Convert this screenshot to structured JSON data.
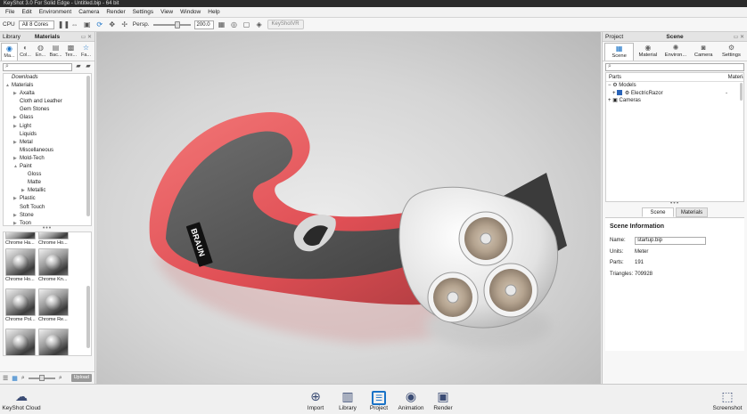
{
  "window": {
    "title": "KeyShot 3.0 For Solid Edge - Untitled.bip - 64 bit"
  },
  "menu": [
    "File",
    "Edit",
    "Environment",
    "Camera",
    "Render",
    "Settings",
    "View",
    "Window",
    "Help"
  ],
  "toolbar": {
    "cpu_label": "CPU",
    "cpu_value": "All 8 Cores",
    "persp_label": "Persp.",
    "fov_value": "200.0",
    "keyshotvr_label": "KeyShotVR"
  },
  "library": {
    "header_left": "Library",
    "header_title": "Materials",
    "tabs": [
      {
        "label": "Ma...",
        "icon": "materials-icon"
      },
      {
        "label": "Col...",
        "icon": "colors-icon"
      },
      {
        "label": "En...",
        "icon": "environments-icon"
      },
      {
        "label": "Bac...",
        "icon": "backplates-icon"
      },
      {
        "label": "Tex...",
        "icon": "textures-icon"
      },
      {
        "label": "Fa...",
        "icon": "favorites-icon"
      }
    ],
    "tree": [
      {
        "label": "Downloads",
        "indent": 0,
        "italic": true,
        "arrow": ""
      },
      {
        "label": "Materials",
        "indent": 0,
        "italic": false,
        "arrow": "▲"
      },
      {
        "label": "Axalta",
        "indent": 1,
        "italic": false,
        "arrow": "▶"
      },
      {
        "label": "Cloth and Leather",
        "indent": 1,
        "italic": false,
        "arrow": ""
      },
      {
        "label": "Gem Stones",
        "indent": 1,
        "italic": false,
        "arrow": ""
      },
      {
        "label": "Glass",
        "indent": 1,
        "italic": false,
        "arrow": "▶"
      },
      {
        "label": "Light",
        "indent": 1,
        "italic": false,
        "arrow": "▶"
      },
      {
        "label": "Liquids",
        "indent": 1,
        "italic": false,
        "arrow": ""
      },
      {
        "label": "Metal",
        "indent": 1,
        "italic": false,
        "arrow": "▶"
      },
      {
        "label": "Miscellaneous",
        "indent": 1,
        "italic": false,
        "arrow": ""
      },
      {
        "label": "Mold-Tech",
        "indent": 1,
        "italic": false,
        "arrow": "▶"
      },
      {
        "label": "Paint",
        "indent": 1,
        "italic": false,
        "arrow": "▲"
      },
      {
        "label": "Gloss",
        "indent": 2,
        "italic": false,
        "arrow": ""
      },
      {
        "label": "Matte",
        "indent": 2,
        "italic": false,
        "arrow": ""
      },
      {
        "label": "Metallic",
        "indent": 2,
        "italic": false,
        "arrow": "▶"
      },
      {
        "label": "Plastic",
        "indent": 1,
        "italic": false,
        "arrow": "▶"
      },
      {
        "label": "Soft Touch",
        "indent": 1,
        "italic": false,
        "arrow": ""
      },
      {
        "label": "Stone",
        "indent": 1,
        "italic": false,
        "arrow": "▶"
      },
      {
        "label": "Toon",
        "indent": 1,
        "italic": false,
        "arrow": "▶"
      }
    ],
    "thumbnails": [
      "Chrome Ha...",
      "Chrome Ho...",
      "Chrome Ho...",
      "Chrome Kn...",
      "Chrome Pol...",
      "Chrome Re..."
    ],
    "upload_label": "Upload"
  },
  "project": {
    "header_left": "Project",
    "header_title": "Scene",
    "tabs": [
      {
        "label": "Scene",
        "icon": "scene-icon"
      },
      {
        "label": "Material",
        "icon": "material-icon"
      },
      {
        "label": "Environ...",
        "icon": "environment-icon"
      },
      {
        "label": "Camera",
        "icon": "camera-icon"
      },
      {
        "label": "Settings",
        "icon": "settings-icon"
      }
    ],
    "tree_header": {
      "parts": "Parts",
      "material": "Material"
    },
    "tree": [
      {
        "label": "Models",
        "indent": 0
      },
      {
        "label": "ElectricRazor",
        "indent": 1,
        "dash": "-"
      },
      {
        "label": "Cameras",
        "indent": 0
      }
    ],
    "subtabs": [
      "Scene",
      "Materials"
    ],
    "info": {
      "title": "Scene Information",
      "name_label": "Name:",
      "name_value": "startup.bip",
      "units_label": "Units:",
      "units_value": "Meter",
      "parts_label": "Parts:",
      "parts_value": "191",
      "triangles_label": "Triangles:",
      "triangles_value": "709928"
    }
  },
  "viewport": {
    "brand_text": "BRAUN"
  },
  "bottombar": {
    "cloud": "KeyShot Cloud",
    "items": [
      {
        "label": "Import",
        "icon": "import-icon"
      },
      {
        "label": "Library",
        "icon": "library-icon"
      },
      {
        "label": "Project",
        "icon": "project-icon"
      },
      {
        "label": "Animation",
        "icon": "animation-icon"
      },
      {
        "label": "Render",
        "icon": "render-icon"
      }
    ],
    "screenshot": "Screenshot"
  }
}
